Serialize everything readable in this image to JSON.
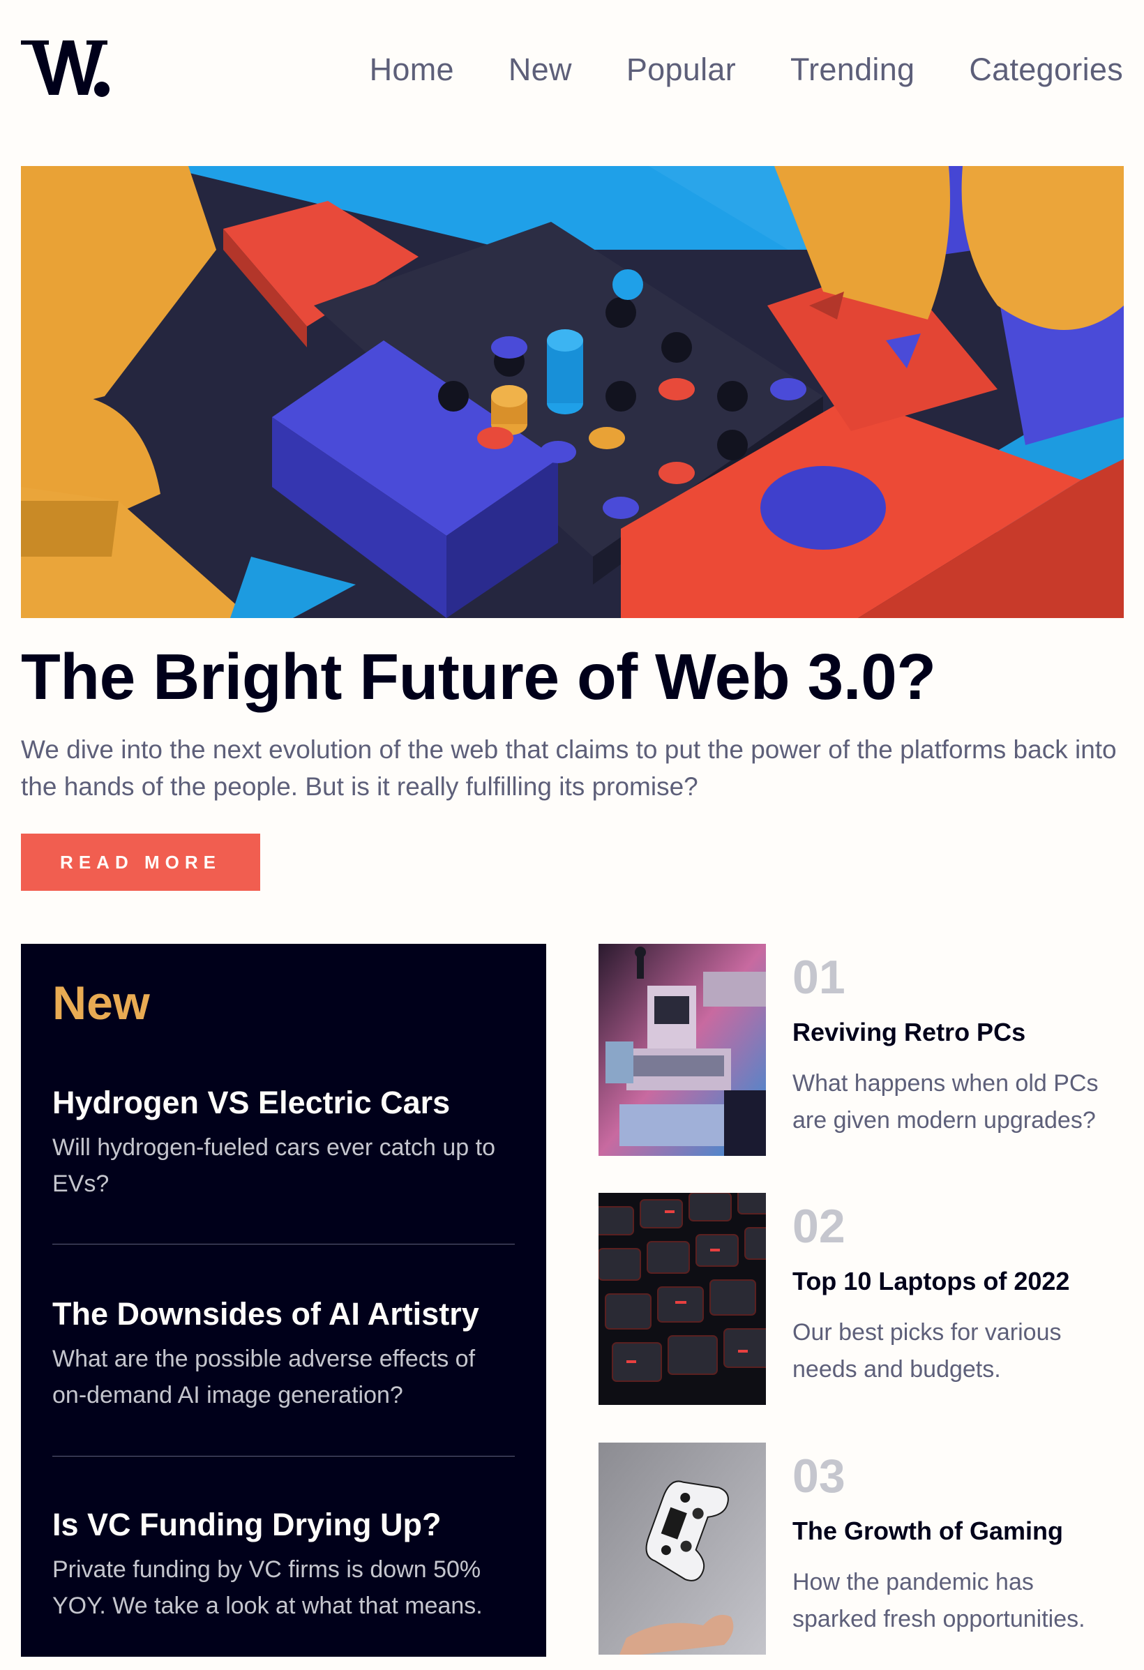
{
  "header": {
    "logo_alt": "W.",
    "nav": [
      "Home",
      "New",
      "Popular",
      "Trending",
      "Categories"
    ]
  },
  "hero": {
    "title": "The Bright Future of Web 3.0?",
    "description": "We dive into the next evolution of the web that claims to put the power of the platforms back into the hands of the people. But is it really fulfilling its promise?",
    "button": "READ MORE"
  },
  "new_panel": {
    "heading": "New",
    "items": [
      {
        "title": "Hydrogen VS Electric Cars",
        "desc": "Will hydrogen-fueled cars ever catch up to EVs?"
      },
      {
        "title": "The Downsides of AI Artistry",
        "desc": "What are the possible adverse effects of on-demand AI image generation?"
      },
      {
        "title": "Is VC Funding Drying Up?",
        "desc": "Private funding by VC firms is down 50% YOY. We take a look at what that means."
      }
    ]
  },
  "numbered": [
    {
      "num": "01",
      "title": "Reviving Retro PCs",
      "desc": "What happens when old PCs are given modern upgrades?",
      "image": "retro-pc-image"
    },
    {
      "num": "02",
      "title": "Top 10 Laptops of 2022",
      "desc": "Our best picks for various needs and budgets.",
      "image": "laptop-keyboard-image"
    },
    {
      "num": "03",
      "title": "The Growth of Gaming",
      "desc": "How the pandemic has sparked fresh opportunities.",
      "image": "game-controller-image"
    }
  ],
  "colors": {
    "background": "#fffdfa",
    "dark": "#00001a",
    "accent_red": "#f15e50",
    "accent_orange": "#e9ab53",
    "grey_blue": "#5d5f79",
    "grayish": "#c5c6ce"
  }
}
